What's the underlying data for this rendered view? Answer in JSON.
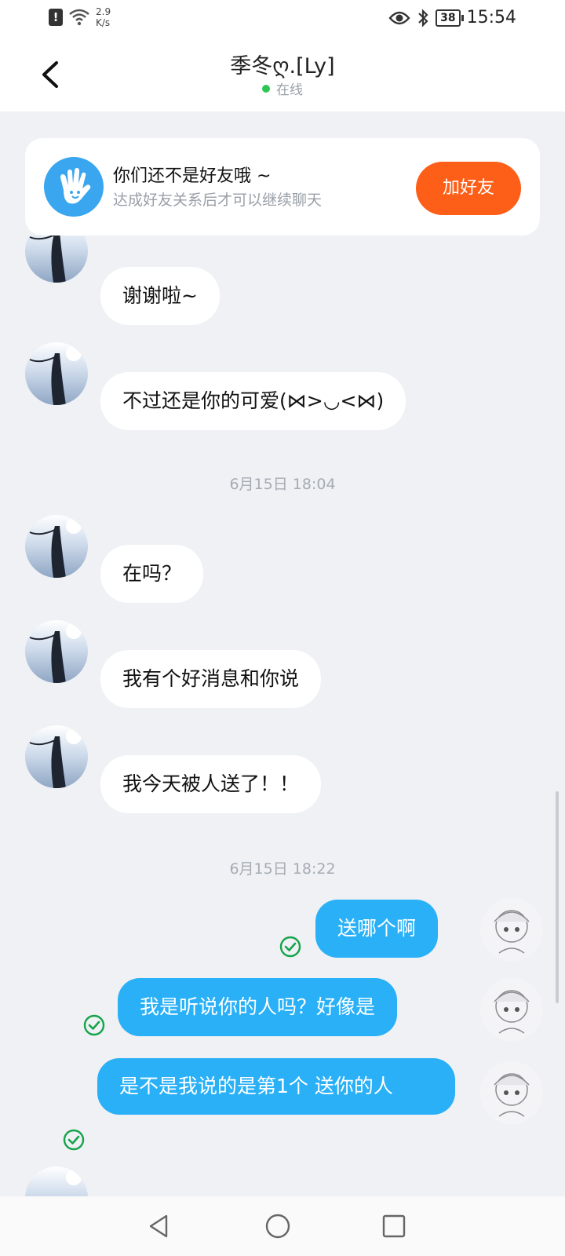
{
  "status_bar": {
    "net_speed_value": "2.9",
    "net_speed_unit": "K/s",
    "battery": "38",
    "time": "15:54"
  },
  "header": {
    "title": "季冬ღ.[Ly]",
    "status": "在线"
  },
  "banner": {
    "title": "你们还不是好友哦 ~",
    "subtitle": "达成好友关系后才可以继续聊天",
    "button": "加好友"
  },
  "messages": [
    {
      "side": "left",
      "text": "谢谢啦~"
    },
    {
      "side": "left",
      "text": "不过还是你的可爱(⋈>◡<⋈)"
    },
    {
      "type": "time",
      "text": "6月15日 18:04"
    },
    {
      "side": "left",
      "text": "在吗？"
    },
    {
      "side": "left",
      "text": "我有个好消息和你说"
    },
    {
      "side": "left",
      "text": "我今天被人送了！！"
    },
    {
      "type": "time",
      "text": "6月15日 18:22"
    },
    {
      "side": "right",
      "text": "送哪个啊",
      "read": true
    },
    {
      "side": "right",
      "text": "我是听说你的人吗？好像是",
      "read": true
    },
    {
      "side": "right",
      "text": "是不是我说的是第1个 送你的人",
      "read": true
    }
  ],
  "colors": {
    "accent_blue": "#29b0f7",
    "add_friend_orange": "#fd5e18",
    "online_green": "#2dc653",
    "read_check_green": "#16a34a"
  },
  "icons": [
    "back-arrow-icon",
    "hand-wave-icon",
    "read-check-icon",
    "eye-icon",
    "bluetooth-icon",
    "wifi-icon",
    "nav-back-icon",
    "nav-home-icon",
    "nav-recents-icon"
  ]
}
